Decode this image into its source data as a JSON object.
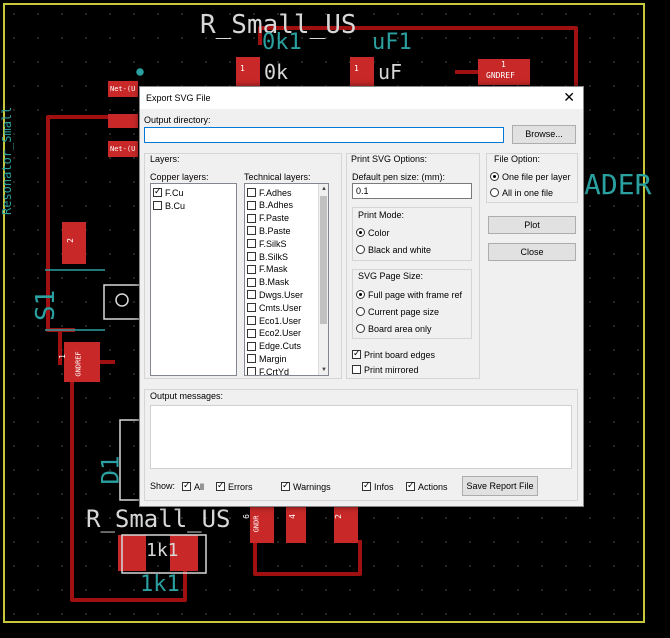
{
  "pcb": {
    "ref_r_small_us": "R_Small_US",
    "value_0k1": "0k1",
    "value_uf1": "uF1",
    "val_0k_small": "0k",
    "val_uf_small": "uF",
    "resonator_label": "Resonator_Small",
    "header_text": "ADER",
    "s1_label": "S1",
    "d1_label": "D1",
    "ref_r_small_us_2": "R_Small_US",
    "value_1k1": "1k1",
    "val_1k1_small": "1k1",
    "pad_1": "1",
    "pad_2": "2",
    "pad_4": "4",
    "pad_6": "6",
    "net_gndref": "GNDREF",
    "net_u": "Net-(U",
    "net_label_small": "Net-(",
    "gnd_short": "GNDR"
  },
  "dialog": {
    "title": "Export SVG File",
    "close_glyph": "✕",
    "output_dir_label": "Output directory:",
    "output_dir_value": "",
    "browse_label": "Browse...",
    "layers_group": "Layers:",
    "copper_label": "Copper layers:",
    "copper_layers": [
      {
        "name": "F.Cu",
        "checked": true
      },
      {
        "name": "B.Cu",
        "checked": false
      }
    ],
    "technical_label": "Technical layers:",
    "technical_layers": [
      {
        "name": "F.Adhes",
        "checked": false
      },
      {
        "name": "B.Adhes",
        "checked": false
      },
      {
        "name": "F.Paste",
        "checked": false
      },
      {
        "name": "B.Paste",
        "checked": false
      },
      {
        "name": "F.SilkS",
        "checked": false
      },
      {
        "name": "B.SilkS",
        "checked": false
      },
      {
        "name": "F.Mask",
        "checked": false
      },
      {
        "name": "B.Mask",
        "checked": false
      },
      {
        "name": "Dwgs.User",
        "checked": false
      },
      {
        "name": "Cmts.User",
        "checked": false
      },
      {
        "name": "Eco1.User",
        "checked": false
      },
      {
        "name": "Eco2.User",
        "checked": false
      },
      {
        "name": "Edge.Cuts",
        "checked": false
      },
      {
        "name": "Margin",
        "checked": false
      },
      {
        "name": "F.CrtYd",
        "checked": false
      }
    ],
    "print_options_label": "Print SVG Options:",
    "pen_size_label": "Default pen size: (mm):",
    "pen_size_value": "0.1",
    "print_mode_label": "Print Mode:",
    "print_mode_options": [
      {
        "label": "Color",
        "selected": true
      },
      {
        "label": "Black and white",
        "selected": false
      }
    ],
    "page_size_label": "SVG Page Size:",
    "page_size_options": [
      {
        "label": "Full page with  frame ref",
        "selected": true
      },
      {
        "label": "Current page size",
        "selected": false
      },
      {
        "label": "Board area only",
        "selected": false
      }
    ],
    "print_board_edges": {
      "label": "Print board edges",
      "checked": true
    },
    "print_mirrored": {
      "label": "Print mirrored",
      "checked": false
    },
    "file_option_label": "File Option:",
    "file_options": [
      {
        "label": "One file per layer",
        "selected": true
      },
      {
        "label": "All in one file",
        "selected": false
      }
    ],
    "plot_label": "Plot",
    "close_label": "Close",
    "output_messages_label": "Output messages:",
    "show_label": "Show:",
    "filters": [
      {
        "label": "All",
        "checked": true
      },
      {
        "label": "Errors",
        "checked": true
      },
      {
        "label": "Warnings",
        "checked": true
      },
      {
        "label": "Infos",
        "checked": true
      },
      {
        "label": "Actions",
        "checked": true
      }
    ],
    "save_report_label": "Save Report File"
  },
  "colors": {
    "board_outline": "#c8c83a",
    "track": "#a01010",
    "pad": "#c82828",
    "silk_cyan": "#2aa0a0",
    "silk_white": "#d8d8d8"
  }
}
